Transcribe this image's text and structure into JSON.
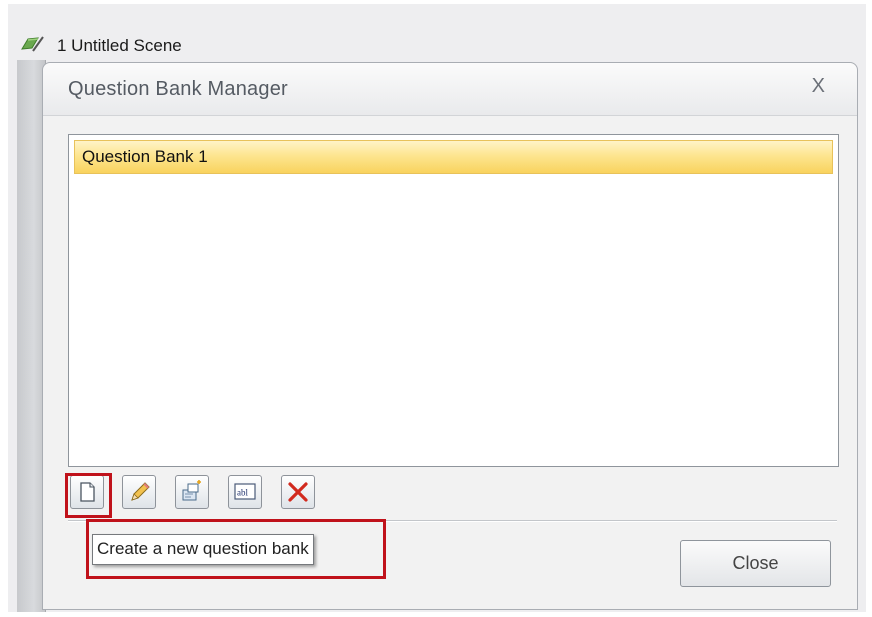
{
  "scene": {
    "label": "1 Untitled Scene",
    "icon": "scene-flag-icon"
  },
  "dialog": {
    "title": "Question Bank Manager",
    "close_glyph": "X",
    "list": {
      "items": [
        {
          "label": "Question Bank 1",
          "selected": true
        }
      ]
    },
    "toolbar": {
      "buttons": [
        {
          "name": "new-question-bank-button",
          "icon": "new-document-icon"
        },
        {
          "name": "edit-question-bank-button",
          "icon": "pencil-icon"
        },
        {
          "name": "import-question-bank-button",
          "icon": "import-icon"
        },
        {
          "name": "rename-question-bank-button",
          "icon": "rename-abl-icon",
          "icon_text": "abl"
        },
        {
          "name": "delete-question-bank-button",
          "icon": "delete-x-icon"
        }
      ]
    },
    "tooltip": "Create a new question bank",
    "close_button_label": "Close"
  },
  "colors": {
    "selection_fill": "#f9d35e",
    "highlight_border": "#c0121b",
    "delete_red": "#d22a1e"
  }
}
